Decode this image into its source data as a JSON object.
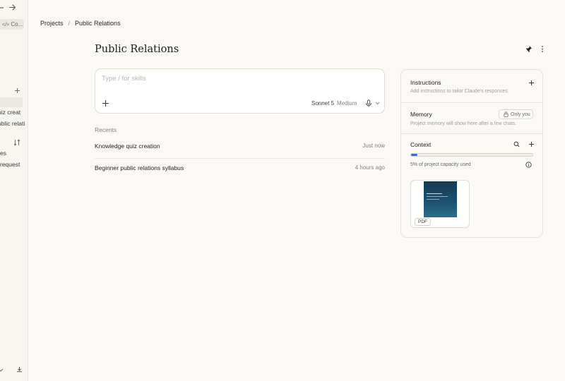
{
  "sidebar": {
    "code_chip_label": "Co...",
    "chat_items": [
      "uiz creat",
      "ublic relati"
    ],
    "extra_items": [
      "es",
      "request"
    ]
  },
  "breadcrumb": {
    "parent": "Projects",
    "separator": "/",
    "current": "Public Relations"
  },
  "project": {
    "title": "Public Relations"
  },
  "composer": {
    "placeholder": "Type / for skills",
    "model": "Sonnet 5",
    "effort": "Medium"
  },
  "recents": {
    "heading": "Recents",
    "items": [
      {
        "title": "Knowledge quiz creation",
        "time": "Just now"
      },
      {
        "title": "Beginner public relations syllabus",
        "time": "4 hours ago"
      }
    ]
  },
  "panel": {
    "instructions": {
      "title": "Instructions",
      "subtitle": "Add instructions to tailor Claude's responses"
    },
    "memory": {
      "title": "Memory",
      "subtitle": "Project memory will show here after a few chats.",
      "badge": "Only you"
    },
    "context": {
      "title": "Context",
      "capacity_text": "5% of project capacity used",
      "capacity_percent": 5
    },
    "file": {
      "type_badge": "PDF"
    }
  },
  "colors": {
    "background": "#faf9f5",
    "capacity_fill": "#2f6fd0",
    "thumbnail": "#1d4f6e"
  }
}
